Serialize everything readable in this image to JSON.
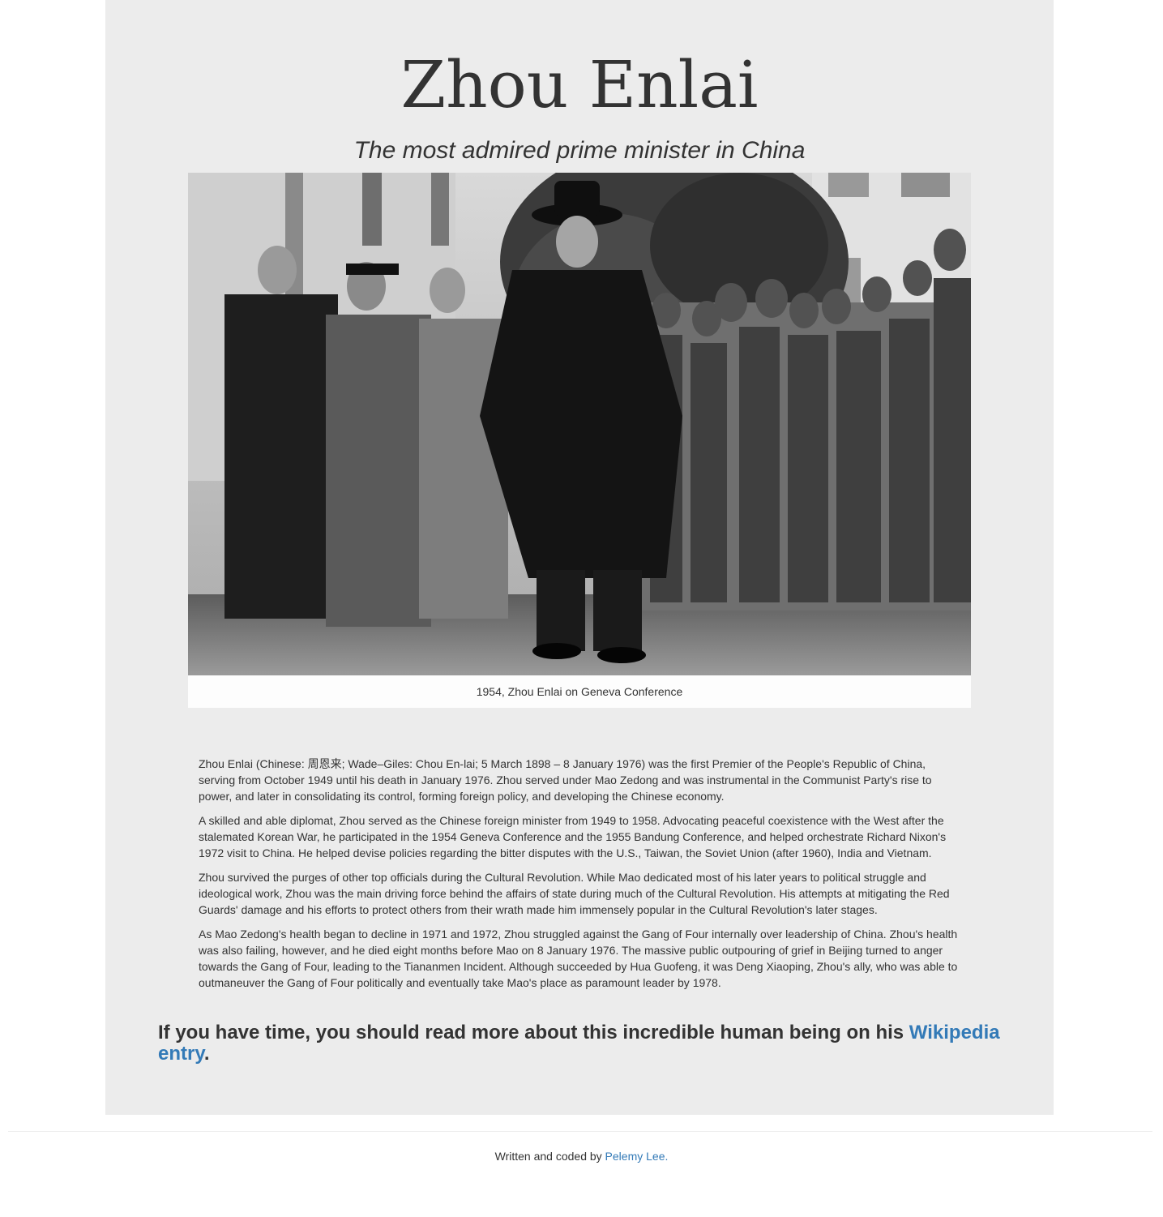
{
  "header": {
    "title": "Zhou Enlai",
    "subtitle": "The most admired prime minister in China"
  },
  "figure": {
    "image_description": "black-and-white photo of Zhou Enlai walking in a hat and long coat, followed by officials, with a crowd of soldiers and onlookers",
    "caption": "1954, Zhou Enlai on Geneva Conference"
  },
  "bio": {
    "paragraphs": [
      "Zhou Enlai (Chinese: 周恩来; Wade–Giles: Chou En-lai; 5 March 1898 – 8 January 1976) was the first Premier of the People's Republic of China, serving from October 1949 until his death in January 1976. Zhou served under Mao Zedong and was instrumental in the Communist Party's rise to power, and later in consolidating its control, forming foreign policy, and developing the Chinese economy.",
      "A skilled and able diplomat, Zhou served as the Chinese foreign minister from 1949 to 1958. Advocating peaceful coexistence with the West after the stalemated Korean War, he participated in the 1954 Geneva Conference and the 1955 Bandung Conference, and helped orchestrate Richard Nixon's 1972 visit to China. He helped devise policies regarding the bitter disputes with the U.S., Taiwan, the Soviet Union (after 1960), India and Vietnam.",
      "Zhou survived the purges of other top officials during the Cultural Revolution. While Mao dedicated most of his later years to political struggle and ideological work, Zhou was the main driving force behind the affairs of state during much of the Cultural Revolution. His attempts at mitigating the Red Guards' damage and his efforts to protect others from their wrath made him immensely popular in the Cultural Revolution's later stages.",
      "As Mao Zedong's health began to decline in 1971 and 1972, Zhou struggled against the Gang of Four internally over leadership of China. Zhou's health was also failing, however, and he died eight months before Mao on 8 January 1976. The massive public outpouring of grief in Beijing turned to anger towards the Gang of Four, leading to the Tiananmen Incident. Although succeeded by Hua Guofeng, it was Deng Xiaoping, Zhou's ally, who was able to outmaneuver the Gang of Four politically and eventually take Mao's place as paramount leader by 1978."
    ]
  },
  "more": {
    "text_before": "If you have time, you should read more about this incredible human being on his ",
    "link_label": "Wikipedia entry",
    "text_after": "."
  },
  "footer": {
    "text": "Written and coded by ",
    "link_label": "Pelemy Lee."
  },
  "colors": {
    "well_background": "#ececec",
    "link": "#337ab7",
    "text": "#333333"
  }
}
